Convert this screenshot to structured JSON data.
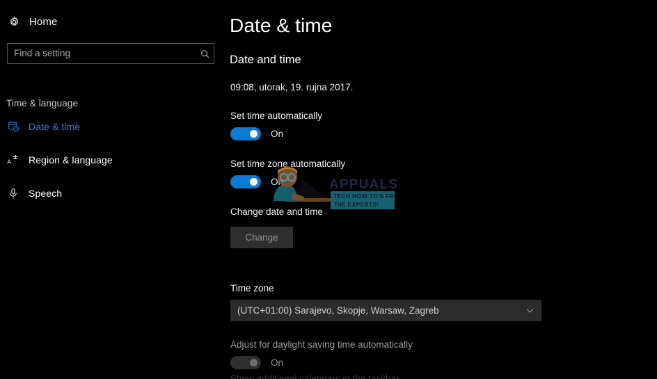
{
  "sidebar": {
    "home": {
      "label": "Home",
      "icon": "gear-icon"
    },
    "search": {
      "placeholder": "Find a setting",
      "value": "",
      "icon": "search-icon"
    },
    "group_title": "Time & language",
    "items": [
      {
        "label": "Date & time",
        "icon": "calendar-clock-icon",
        "selected": true
      },
      {
        "label": "Region & language",
        "icon": "language-icon",
        "selected": false
      },
      {
        "label": "Speech",
        "icon": "microphone-icon",
        "selected": false
      }
    ]
  },
  "main": {
    "page_title": "Date & time",
    "section_heading": "Date and time",
    "current_datetime": "09:08, utorak, 19. rujna 2017.",
    "set_time_auto": {
      "label": "Set time automatically",
      "state_text": "On",
      "enabled": true
    },
    "set_timezone_auto": {
      "label": "Set time zone automatically",
      "state_text": "On",
      "enabled": true
    },
    "change_datetime": {
      "label": "Change date and time",
      "button_label": "Change",
      "button_disabled": true
    },
    "time_zone": {
      "label": "Time zone",
      "selected": "(UTC+01:00) Sarajevo, Skopje, Warsaw, Zagreb",
      "chevron": "chevron-down-icon"
    },
    "dst": {
      "label": "Adjust for daylight saving time automatically",
      "state_text": "On",
      "enabled": false
    },
    "cut_off_text": "Show additional calendars in the taskbar"
  },
  "watermark": {
    "brand": "APPUALS",
    "tagline_line1": "TECH HOW-TO'S FROM",
    "tagline_line2": "THE EXPERTS!"
  },
  "colors": {
    "background": "#000000",
    "accent_blue": "#0b7ad4",
    "selected_nav": "#2a7fd4",
    "control_bg": "#2b2b2b",
    "disabled_text": "#8f8f8f",
    "watermark_brand": "#2a2a55",
    "watermark_banner": "#1c6f80"
  }
}
